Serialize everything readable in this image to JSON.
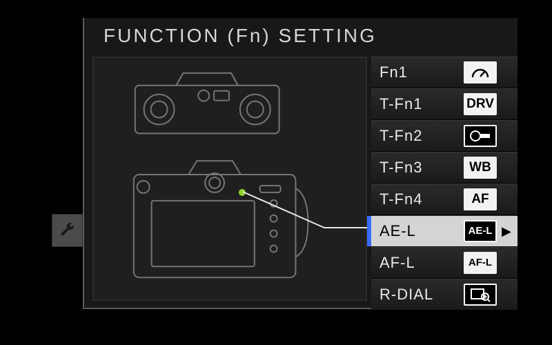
{
  "title": "FUNCTION (Fn) SETTING",
  "menu": {
    "items": [
      {
        "label": "Fn1",
        "icon": "gauge",
        "icon_text": ""
      },
      {
        "label": "T-Fn1",
        "icon": "drv",
        "icon_text": "DRV"
      },
      {
        "label": "T-Fn2",
        "icon": "film",
        "icon_text": ""
      },
      {
        "label": "T-Fn3",
        "icon": "wb",
        "icon_text": "WB"
      },
      {
        "label": "T-Fn4",
        "icon": "af",
        "icon_text": "AF"
      },
      {
        "label": "AE-L",
        "icon": "ael",
        "icon_text": "AE-L",
        "selected": true
      },
      {
        "label": "AF-L",
        "icon": "afl",
        "icon_text": "AF-L"
      },
      {
        "label": "R-DIAL",
        "icon": "magnify",
        "icon_text": ""
      }
    ]
  },
  "side_tab": {
    "icon": "wrench"
  },
  "highlight_dot": {
    "color": "#8bd52a"
  }
}
